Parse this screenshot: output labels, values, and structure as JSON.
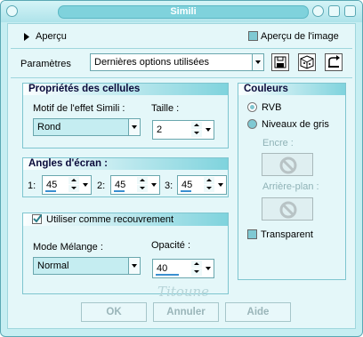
{
  "window": {
    "title": "Simili"
  },
  "header": {
    "preview_label": "Aperçu",
    "image_preview_label": "Aperçu de l'image",
    "params_label": "Paramètres",
    "preset_value": "Dernières options utilisées"
  },
  "cells": {
    "title": "Propriétés des cellules",
    "pattern_label": "Motif de l'effet Simili :",
    "pattern_value": "Rond",
    "size_label": "Taille :",
    "size_value": "2"
  },
  "angles": {
    "title": "Angles d'écran :",
    "items": [
      {
        "index": "1:",
        "value": "45"
      },
      {
        "index": "2:",
        "value": "45"
      },
      {
        "index": "3:",
        "value": "45"
      }
    ]
  },
  "overlay": {
    "checkbox_label": "Utiliser comme recouvrement",
    "blend_label": "Mode Mélange :",
    "blend_value": "Normal",
    "opacity_label": "Opacité :",
    "opacity_value": "40"
  },
  "colors": {
    "title": "Couleurs",
    "rgb_label": "RVB",
    "gray_label": "Niveaux de gris",
    "ink_label": "Encre :",
    "background_label": "Arrière-plan :",
    "transparent_label": "Transparent"
  },
  "footer": {
    "ok_label": "OK",
    "cancel_label": "Annuler",
    "help_label": "Aide",
    "watermark": "Titoune"
  },
  "theme": {
    "accent": "#7fd3dd",
    "background": "#e4f7f9",
    "frame": "#c6eef2"
  }
}
